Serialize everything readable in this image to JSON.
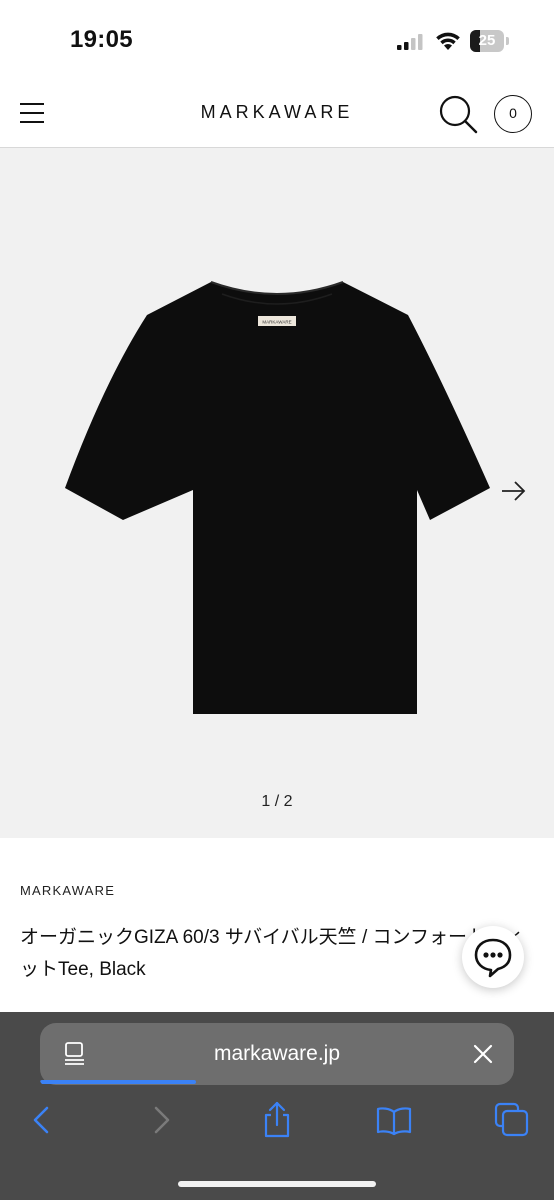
{
  "status_bar": {
    "time": "19:05",
    "battery_level": "25"
  },
  "header": {
    "logo": "MARKAWARE",
    "cart_count": "0"
  },
  "gallery": {
    "pager": "1 / 2",
    "product_color": "#0d0d0d",
    "background": "#f1f1f1",
    "tag_text": "MARKAWARE"
  },
  "product": {
    "brand": "MARKAWARE",
    "title": "オーガニックGIZA 60/3 サバイバル天竺 / コンフォートフィットTee, Black"
  },
  "browser": {
    "url": "markaware.jp",
    "load_progress": 0.33,
    "accent": "#3b82f6"
  },
  "icons": {
    "menu": "hamburger-menu-icon",
    "search": "search-icon",
    "cart": "cart-count-badge",
    "next": "arrow-right-icon",
    "chat": "chat-bubble-icon",
    "reader": "reader-mode-icon",
    "close": "close-icon",
    "back": "chevron-left-icon",
    "forward": "chevron-right-icon",
    "share": "share-icon",
    "bookmarks": "book-icon",
    "tabs": "tabs-icon"
  }
}
